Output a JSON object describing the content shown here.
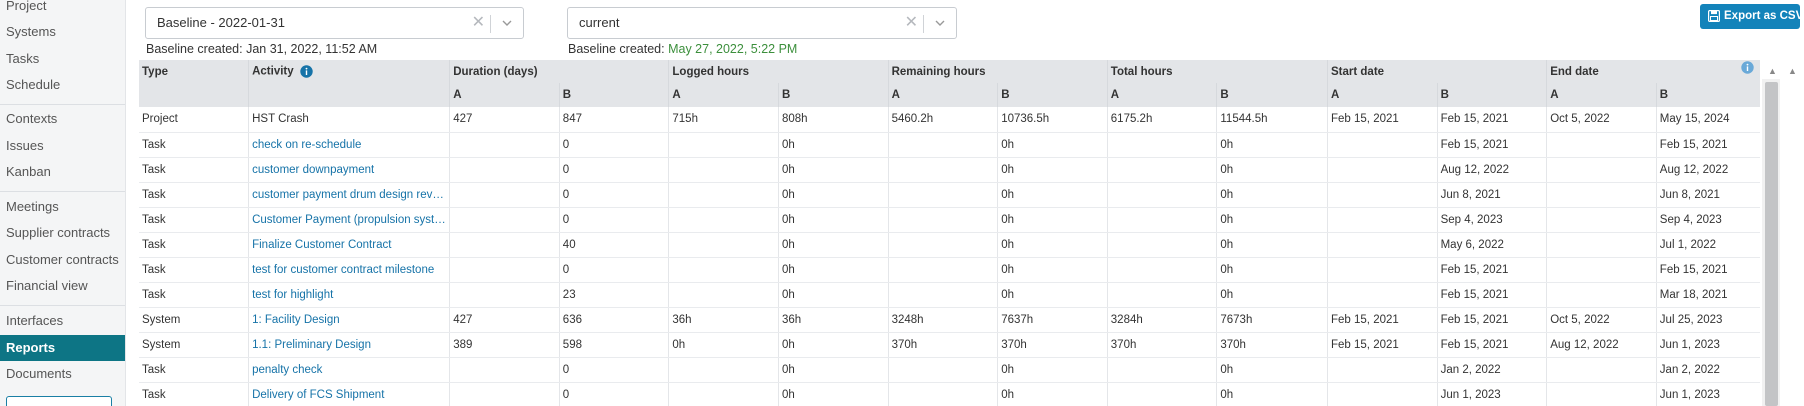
{
  "sidebar": {
    "items": [
      {
        "label": "Project"
      },
      {
        "label": "Systems"
      },
      {
        "label": "Tasks"
      },
      {
        "label": "Schedule"
      },
      {
        "label": "Contexts"
      },
      {
        "label": "Issues"
      },
      {
        "label": "Kanban"
      },
      {
        "label": "Meetings"
      },
      {
        "label": "Supplier contracts"
      },
      {
        "label": "Customer contracts"
      },
      {
        "label": "Financial view"
      },
      {
        "label": "Interfaces"
      },
      {
        "label": "Reports",
        "active": true
      },
      {
        "label": "Documents"
      }
    ]
  },
  "filters": {
    "baseline_a": {
      "value": "Baseline - 2022-01-31",
      "created_label": "Baseline created:",
      "created_value": "Jan 31, 2022, 11:52 AM"
    },
    "baseline_b": {
      "value": "current",
      "created_label": "Baseline created:",
      "created_value": "May 27, 2022, 5:22 PM"
    }
  },
  "export_button": "Export as CSV",
  "colors": {
    "accent": "#0d7585",
    "link": "#1673a8",
    "button": "#1383ba",
    "green": "#3c8f3c"
  },
  "table": {
    "headers": {
      "type": "Type",
      "activity": "Activity",
      "duration": "Duration (days)",
      "logged": "Logged hours",
      "remaining": "Remaining hours",
      "total": "Total hours",
      "start": "Start date",
      "end": "End date",
      "a": "A",
      "b": "B"
    },
    "rows": [
      [
        "Project",
        "HST Crash",
        "427",
        "847",
        "715h",
        "808h",
        "5460.2h",
        "10736.5h",
        "6175.2h",
        "11544.5h",
        "Feb 15, 2021",
        "Feb 15, 2021",
        "Oct 5, 2022",
        "May 15, 2024"
      ],
      [
        "Task",
        "check on re-schedule",
        "",
        "0",
        "",
        "0h",
        "",
        "0h",
        "",
        "0h",
        "",
        "Feb 15, 2021",
        "",
        "Feb 15, 2021"
      ],
      [
        "Task",
        "customer downpayment",
        "",
        "0",
        "",
        "0h",
        "",
        "0h",
        "",
        "0h",
        "",
        "Aug 12, 2022",
        "",
        "Aug 12, 2022"
      ],
      [
        "Task",
        "customer payment drum design review",
        "",
        "0",
        "",
        "0h",
        "",
        "0h",
        "",
        "0h",
        "",
        "Jun 8, 2021",
        "",
        "Jun 8, 2021"
      ],
      [
        "Task",
        "Customer Payment (propulsion syste…",
        "",
        "0",
        "",
        "0h",
        "",
        "0h",
        "",
        "0h",
        "",
        "Sep 4, 2023",
        "",
        "Sep 4, 2023"
      ],
      [
        "Task",
        "Finalize Customer Contract",
        "",
        "40",
        "",
        "0h",
        "",
        "0h",
        "",
        "0h",
        "",
        "May 6, 2022",
        "",
        "Jul 1, 2022"
      ],
      [
        "Task",
        "test for customer contract milestone",
        "",
        "0",
        "",
        "0h",
        "",
        "0h",
        "",
        "0h",
        "",
        "Feb 15, 2021",
        "",
        "Feb 15, 2021"
      ],
      [
        "Task",
        "test for highlight",
        "",
        "23",
        "",
        "0h",
        "",
        "0h",
        "",
        "0h",
        "",
        "Feb 15, 2021",
        "",
        "Mar 18, 2021"
      ],
      [
        "System",
        "1: Facility Design",
        "427",
        "636",
        "36h",
        "36h",
        "3248h",
        "7637h",
        "3284h",
        "7673h",
        "Feb 15, 2021",
        "Feb 15, 2021",
        "Oct 5, 2022",
        "Jul 25, 2023"
      ],
      [
        "System",
        "1.1: Preliminary Design",
        "389",
        "598",
        "0h",
        "0h",
        "370h",
        "370h",
        "370h",
        "370h",
        "Feb 15, 2021",
        "Feb 15, 2021",
        "Aug 12, 2022",
        "Jun 1, 2023"
      ],
      [
        "Task",
        "penalty check",
        "",
        "0",
        "",
        "0h",
        "",
        "0h",
        "",
        "0h",
        "",
        "Jan 2, 2022",
        "",
        "Jan 2, 2022"
      ],
      [
        "Task",
        "Delivery of FCS Shipment",
        "",
        "0",
        "",
        "0h",
        "",
        "0h",
        "",
        "0h",
        "",
        "Jun 1, 2023",
        "",
        "Jun 1, 2023"
      ]
    ]
  }
}
